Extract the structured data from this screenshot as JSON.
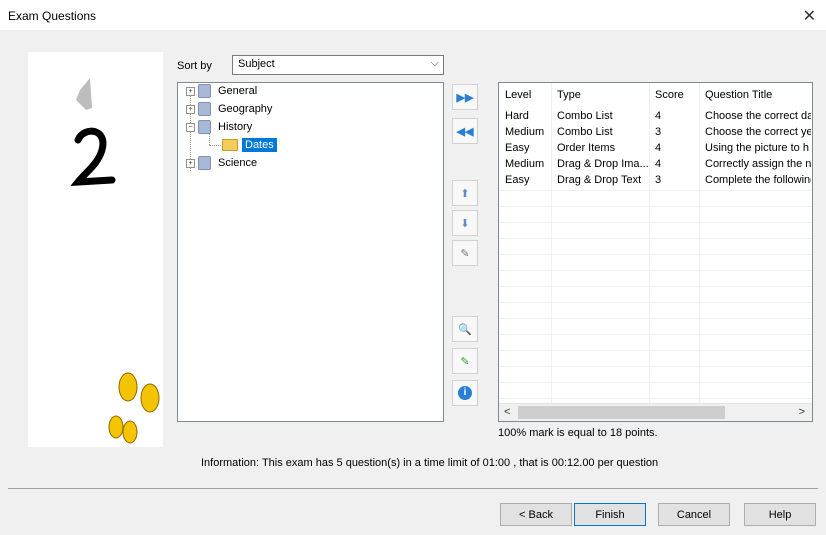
{
  "window": {
    "title": "Exam Questions"
  },
  "sort": {
    "label": "Sort by",
    "value": "Subject"
  },
  "tree": {
    "general": "General",
    "geography": "Geography",
    "history": "History",
    "dates": "Dates",
    "science": "Science"
  },
  "grid": {
    "columns": [
      "Level",
      "Type",
      "Score",
      "Question Title"
    ],
    "rows": [
      [
        "Hard",
        "Combo List",
        "4",
        "Choose the correct da"
      ],
      [
        "Medium",
        "Combo List",
        "3",
        "Choose the correct ye"
      ],
      [
        "Easy",
        "Order Items",
        "4",
        "Using the picture to h"
      ],
      [
        "Medium",
        "Drag & Drop Ima...",
        "4",
        "Correctly assign the n"
      ],
      [
        "Easy",
        "Drag & Drop Text",
        "3",
        "Complete the following"
      ]
    ]
  },
  "mark_text": "100% mark is equal to 18 points.",
  "info_text": "Information: This exam has 5 question(s) in a time limit of 01:00 , that is 00:12.00 per question",
  "buttons": {
    "back": "< Back",
    "finish": "Finish",
    "cancel": "Cancel",
    "help": "Help"
  },
  "colors": {
    "selection": "#0078d7",
    "footsteps": "#f5c400"
  }
}
